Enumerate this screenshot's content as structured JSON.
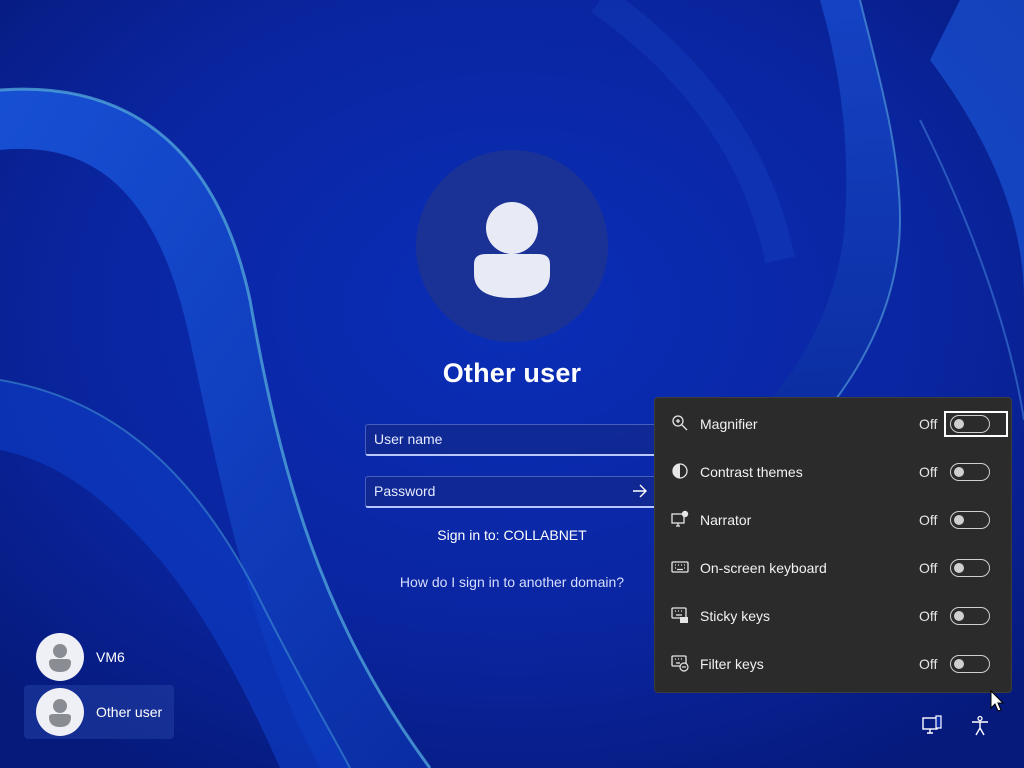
{
  "login": {
    "title": "Other user",
    "username_placeholder": "User name",
    "password_placeholder": "Password",
    "sign_in_to": "Sign in to: COLLABNET",
    "domain_link": "How do I sign in to another domain?"
  },
  "users": [
    {
      "name": "VM6",
      "selected": false
    },
    {
      "name": "Other user",
      "selected": true
    }
  ],
  "accessibility": {
    "items": [
      {
        "label": "Magnifier",
        "state": "Off",
        "icon": "magnifier-icon"
      },
      {
        "label": "Contrast themes",
        "state": "Off",
        "icon": "contrast-icon"
      },
      {
        "label": "Narrator",
        "state": "Off",
        "icon": "narrator-icon"
      },
      {
        "label": "On-screen keyboard",
        "state": "Off",
        "icon": "keyboard-icon"
      },
      {
        "label": "Sticky keys",
        "state": "Off",
        "icon": "sticky-keys-icon"
      },
      {
        "label": "Filter keys",
        "state": "Off",
        "icon": "filter-keys-icon"
      }
    ]
  },
  "tray": {
    "icons": [
      "network-icon",
      "accessibility-icon"
    ]
  },
  "colors": {
    "wallpaper": "#0b2aa8",
    "panel": "#2b2b2b",
    "avatar": "#1a3296"
  }
}
